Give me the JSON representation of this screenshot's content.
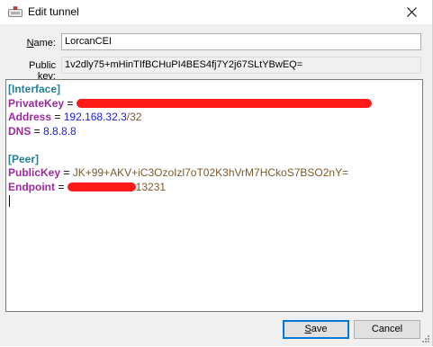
{
  "window": {
    "title": "Edit tunnel",
    "app_icon": "wireguard-tunnel-icon",
    "close_icon": "close-icon"
  },
  "form": {
    "name_label_prefix": "N",
    "name_label_rest": "ame:",
    "name_value": "LorcanCEI",
    "public_key_label": "Public key:",
    "public_key_value": "1v2dly75+mHinTIfBCHuPI4BES4fj7Y2j67SLtYBwEQ="
  },
  "config": {
    "interface_header": "[Interface]",
    "private_key_key": "PrivateKey",
    "address_key": "Address",
    "address_ip": "192.168.32.3",
    "address_mask": "/32",
    "dns_key": "DNS",
    "dns_value": "8.8.8.8",
    "peer_header": "[Peer]",
    "peer_public_key_key": "PublicKey",
    "peer_public_key_value": "JK+99+AKV+iC3OzoIzl7oT02K3hVrM7HCkoS7BSO2nY=",
    "endpoint_key": "Endpoint",
    "endpoint_port_suffix": "13231",
    "equals": " = "
  },
  "buttons": {
    "save_prefix": "S",
    "save_rest": "ave",
    "cancel": "Cancel"
  },
  "colors": {
    "section": "#267f99",
    "key": "#9b2b9b",
    "ip_value": "#1a1ae6",
    "redaction": "#ff1a1a",
    "default_button_border": "#0078d7"
  }
}
